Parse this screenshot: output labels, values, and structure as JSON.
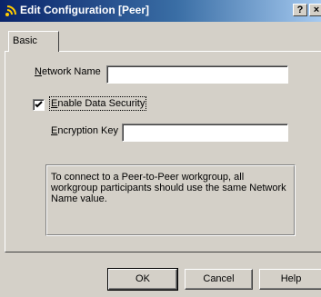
{
  "window": {
    "title": "Edit Configuration [Peer]",
    "help_glyph": "?",
    "close_glyph": "×",
    "icon": "signal-icon"
  },
  "tabs": [
    {
      "label": "Basic"
    }
  ],
  "form": {
    "network_name": {
      "label": "Network Name",
      "value": ""
    },
    "enable_data_security": {
      "label": "Enable Data Security",
      "checked": true
    },
    "encryption_key": {
      "label": "Encryption Key",
      "value": ""
    }
  },
  "info_text": "To connect to a Peer-to-Peer workgroup, all workgroup participants should use the same Network Name value.",
  "buttons": {
    "ok": "OK",
    "cancel": "Cancel",
    "help": "Help"
  },
  "colors": {
    "titlebar_start": "#0a246a",
    "titlebar_end": "#a6caf0",
    "face": "#d4d0c8"
  }
}
